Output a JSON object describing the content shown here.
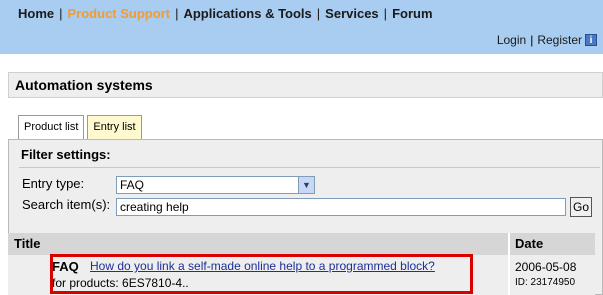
{
  "nav": {
    "items": [
      {
        "label": "Home",
        "active": false
      },
      {
        "label": "Product Support",
        "active": true
      },
      {
        "label": "Applications & Tools",
        "active": false
      },
      {
        "label": "Services",
        "active": false
      },
      {
        "label": "Forum",
        "active": false
      }
    ],
    "separator": "|"
  },
  "util": {
    "login": "Login",
    "separator": "|",
    "register": "Register",
    "info_icon": "i"
  },
  "page": {
    "title": "Automation systems"
  },
  "tabs": [
    {
      "label": "Product list",
      "active": false
    },
    {
      "label": "Entry list",
      "active": true
    }
  ],
  "filter": {
    "heading": "Filter settings:",
    "entry_type_label": "Entry type:",
    "entry_type_value": "FAQ",
    "dropdown_arrow": "▼",
    "search_label": "Search item(s):",
    "search_value": "creating help",
    "go_label": "Go"
  },
  "table": {
    "columns": [
      "Title",
      "Date"
    ],
    "rows": [
      {
        "type": "FAQ",
        "link": "How do you link a self-made online help to a programmed block?",
        "products": "for products: 6ES7810-4..",
        "date": "2006-05-08",
        "id": "ID: 23174950"
      }
    ]
  },
  "colors": {
    "topbar": "#a8cdf0",
    "active_nav": "#f39b2e",
    "highlight": "#d90000",
    "link": "#1c2f9a"
  }
}
